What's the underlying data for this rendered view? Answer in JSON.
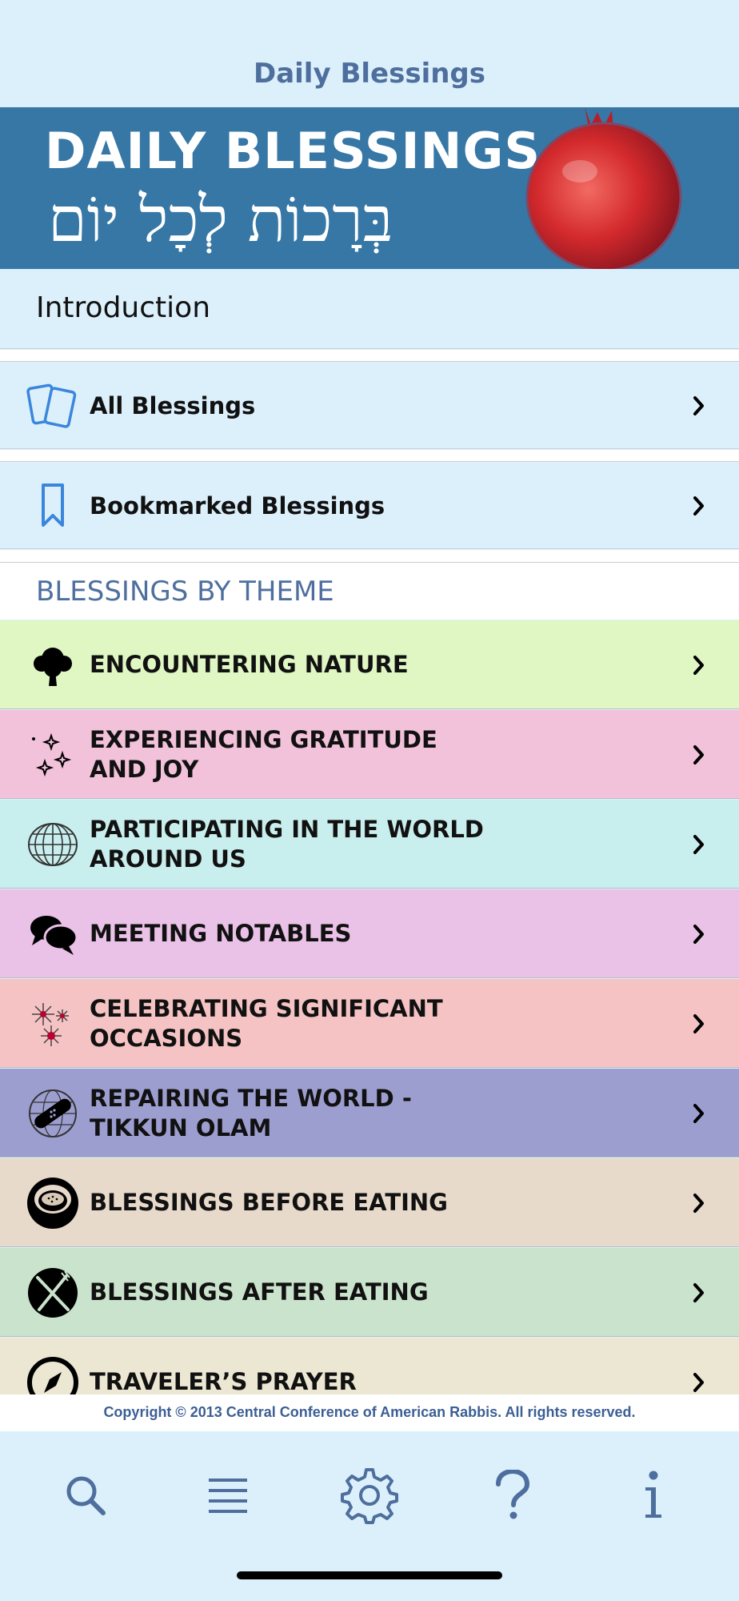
{
  "navbar": {
    "title": "Daily Blessings"
  },
  "banner": {
    "title": "DAILY BLESSINGS",
    "hebrew": "בְּרָכוֹת לְכָל יוֹם"
  },
  "intro": {
    "label": "Introduction"
  },
  "menu": [
    {
      "label": "All Blessings",
      "icon": "cards-icon"
    },
    {
      "label": "Bookmarked Blessings",
      "icon": "bookmark-icon"
    }
  ],
  "section": {
    "label": "BLESSINGS BY THEME"
  },
  "themes": [
    {
      "line1": "ENCOUNTERING NATURE",
      "line2": "",
      "color": "#e0f7c4",
      "icon": "tree-icon"
    },
    {
      "line1": "EXPERIENCING GRATITUDE",
      "line2": "AND JOY",
      "color": "#f2c1da",
      "icon": "stars-icon"
    },
    {
      "line1": "PARTICIPATING IN THE WORLD",
      "line2": "AROUND US",
      "color": "#c8eeed",
      "icon": "globe-icon"
    },
    {
      "line1": "MEETING NOTABLES",
      "line2": "",
      "color": "#eac1e7",
      "icon": "speech-bubbles-icon"
    },
    {
      "line1": "CELEBRATING SIGNIFICANT",
      "line2": "OCCASIONS",
      "color": "#f5c3c3",
      "icon": "fireworks-icon"
    },
    {
      "line1": "REPAIRING THE WORLD -",
      "line2": "TIKKUN OLAM",
      "color": "#9d9ed0",
      "icon": "bandage-globe-icon"
    },
    {
      "line1": "BLESSINGS BEFORE EATING",
      "line2": "",
      "color": "#e7dacb",
      "icon": "bowl-icon"
    },
    {
      "line1": "BLESSINGS AFTER EATING",
      "line2": "",
      "color": "#cae3cc",
      "icon": "fork-knife-icon"
    },
    {
      "line1": "TRAVELER’S PRAYER",
      "line2": "",
      "color": "#ebe7d3",
      "icon": "compass-icon"
    }
  ],
  "footer": {
    "copyright": "Copyright © 2013 Central Conference of American Rabbis. All rights reserved."
  },
  "tabs": [
    {
      "name": "tab-search",
      "icon": "search-icon"
    },
    {
      "name": "tab-list",
      "icon": "list-icon"
    },
    {
      "name": "tab-settings",
      "icon": "gear-icon"
    },
    {
      "name": "tab-help",
      "icon": "question-icon"
    },
    {
      "name": "tab-info",
      "icon": "info-icon"
    }
  ],
  "colors": {
    "accent": "#4e6f9e",
    "banner": "#3677a6",
    "background": "#dcf0fb"
  }
}
